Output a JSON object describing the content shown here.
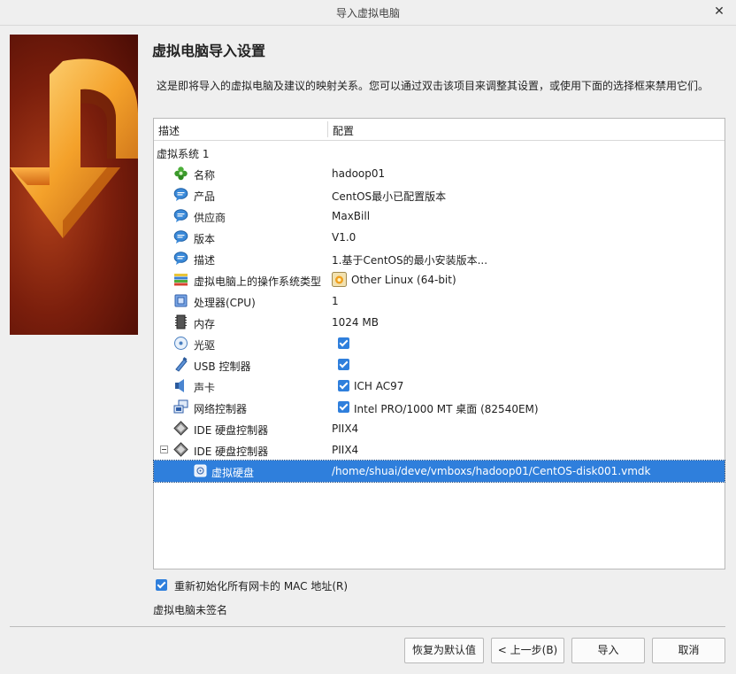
{
  "window": {
    "title": "导入虚拟电脑",
    "close_glyph": "✕"
  },
  "page": {
    "heading": "虚拟电脑导入设置",
    "description": "这是即将导入的虚拟电脑及建议的映射关系。您可以通过双击该项目来调整其设置，或使用下面的选择框来禁用它们。"
  },
  "tree": {
    "col_description": "描述",
    "col_config": "配置",
    "system_label": "虚拟系统 1",
    "rows": [
      {
        "label": "名称",
        "value": "hadoop01",
        "icon": "name-icon"
      },
      {
        "label": "产品",
        "value": "CentOS最小已配置版本",
        "icon": "info-bubble-icon"
      },
      {
        "label": "供应商",
        "value": "MaxBill",
        "icon": "info-bubble-icon"
      },
      {
        "label": "版本",
        "value": "V1.0",
        "icon": "info-bubble-icon"
      },
      {
        "label": "描述",
        "value": "1.基于CentOS的最小安装版本...",
        "icon": "info-bubble-icon"
      },
      {
        "label": "虚拟电脑上的操作系统类型",
        "value": "Other Linux (64-bit)",
        "icon": "os-type-icon"
      },
      {
        "label": "处理器(CPU)",
        "value": "1",
        "icon": "cpu-icon"
      },
      {
        "label": "内存",
        "value": "1024 MB",
        "icon": "memory-icon"
      },
      {
        "label": "光驱",
        "value": "",
        "icon": "optical-drive-icon",
        "checked": true
      },
      {
        "label": "USB 控制器",
        "value": "",
        "icon": "usb-icon",
        "checked": true
      },
      {
        "label": "声卡",
        "value": "ICH AC97",
        "icon": "sound-card-icon",
        "checked": true
      },
      {
        "label": "网络控制器",
        "value": "Intel PRO/1000 MT 桌面 (82540EM)",
        "icon": "network-icon",
        "checked": true
      },
      {
        "label": "IDE 硬盘控制器",
        "value": "PIIX4",
        "icon": "ide-controller-icon"
      },
      {
        "label": "IDE 硬盘控制器",
        "value": "PIIX4",
        "icon": "ide-controller-icon",
        "expanded": true
      },
      {
        "label": "虚拟硬盘",
        "value": "/home/shuai/deve/vmboxs/hadoop01/CentOS-disk001.vmdk",
        "icon": "hard-disk-icon",
        "selected": true
      }
    ]
  },
  "options": {
    "reinit_mac_label": "重新初始化所有网卡的 MAC 地址(R)",
    "reinit_mac_checked": true,
    "signature_status": "虚拟电脑未签名"
  },
  "buttons": {
    "restore_defaults": "恢复为默认值",
    "back": "< 上一步(B)",
    "import": "导入",
    "cancel": "取消"
  },
  "colors": {
    "selection": "#2f7fdc",
    "banner": "#7a1e0c"
  }
}
